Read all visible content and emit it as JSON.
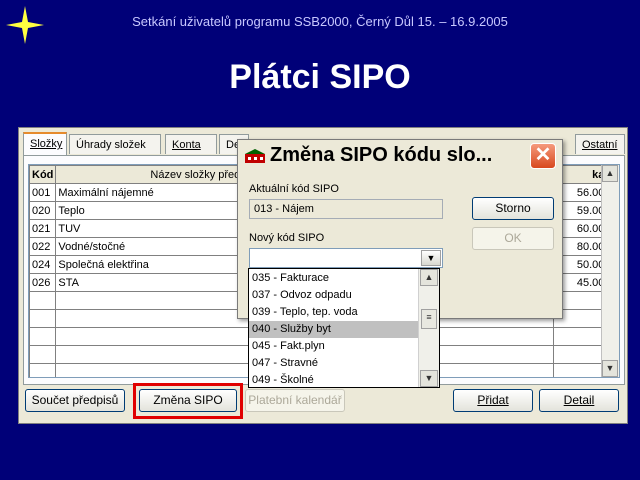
{
  "slide": {
    "header": "Setkání uživatelů programu SSB2000, Černý Důl 15. – 16.9.2005",
    "title": "Plátci SIPO"
  },
  "tabs": [
    {
      "label": "Složky",
      "active": true
    },
    {
      "label": "Úhrady složek"
    },
    {
      "label": "Konta"
    },
    {
      "label": "De"
    },
    {
      "label": "Ostatní"
    }
  ],
  "grid": {
    "headers": {
      "code": "Kód",
      "name": "Název složky předp",
      "amount": "ka"
    },
    "rows": [
      {
        "code": "001",
        "name": "Maximální nájemné",
        "amount": "56.00"
      },
      {
        "code": "020",
        "name": "Teplo",
        "amount": "59.00"
      },
      {
        "code": "021",
        "name": "TUV",
        "amount": "60.00"
      },
      {
        "code": "022",
        "name": "Vodné/stočné",
        "amount": "80.00"
      },
      {
        "code": "024",
        "name": "Společná elektřina",
        "amount": "50.00"
      },
      {
        "code": "026",
        "name": "STA",
        "amount": "45.00"
      }
    ]
  },
  "buttons": {
    "soucet": "Součet předpisů",
    "zmena": "Změna SIPO",
    "kalendar": "Platební kalendář",
    "pridat": "Přidat",
    "detail": "Detail"
  },
  "dialog": {
    "title": "Změna SIPO kódu slo...",
    "current_label": "Aktuální kód SIPO",
    "current_value": "013 - Nájem",
    "new_label": "Nový kód SIPO",
    "new_value": "",
    "storno": "Storno",
    "ok": "OK"
  },
  "dropdown": {
    "items": [
      "035 - Fakturace",
      "037 - Odvoz odpadu",
      "039 - Teplo, tep. voda",
      "040 - Služby byt",
      "045 - Fakt.plyn",
      "047 - Stravné",
      "049 - Školné"
    ],
    "selected": "040 - Služby byt"
  },
  "colors": {
    "slide_background": "#000078",
    "header_text": "#c8c8ff",
    "highlight_border": "#e00000",
    "selected_item": "#c0c0c0",
    "close_button": "#d8481e"
  },
  "icons": {
    "logo": "four-point-star-icon",
    "dialog": "app-icon",
    "close": "close-icon",
    "scroll_up": "chevron-up-icon",
    "scroll_down": "chevron-down-icon",
    "combo": "chevron-down-icon"
  }
}
